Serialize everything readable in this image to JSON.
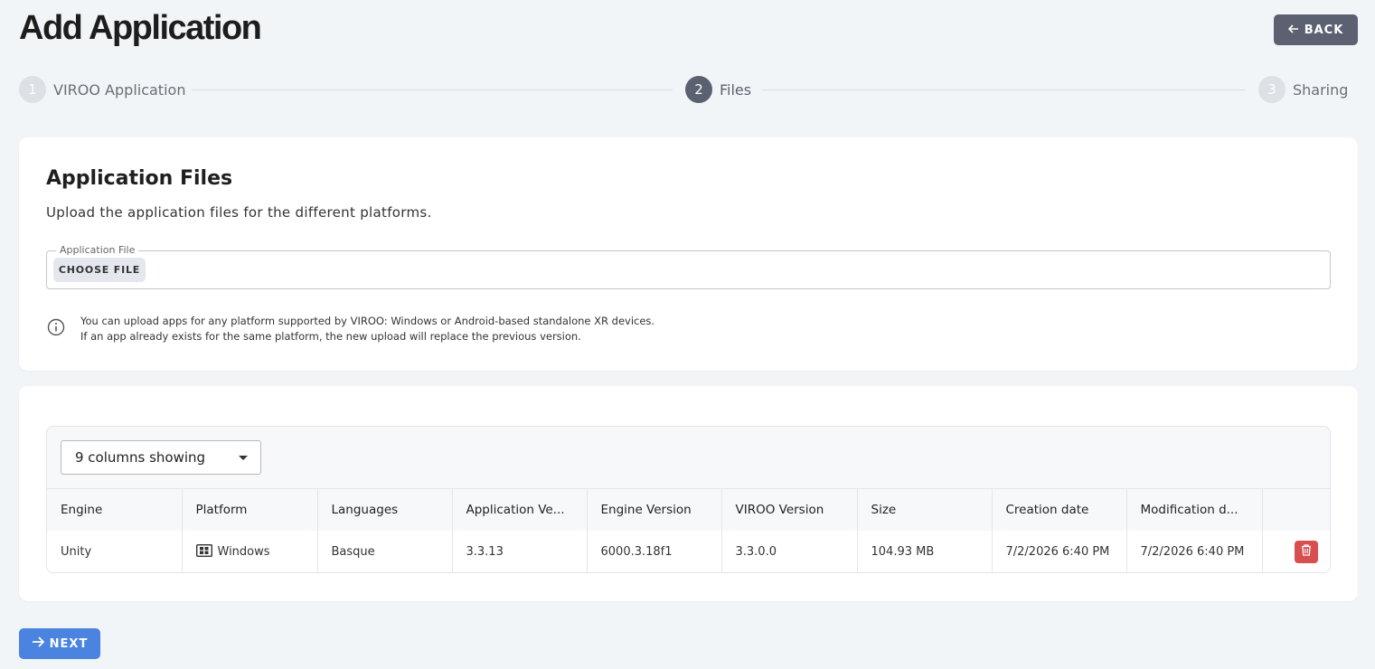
{
  "header": {
    "title": "Add Application",
    "back_label": "BACK"
  },
  "stepper": {
    "steps": [
      {
        "number": "1",
        "label": "VIROO Application",
        "active": false
      },
      {
        "number": "2",
        "label": "Files",
        "active": true
      },
      {
        "number": "3",
        "label": "Sharing",
        "active": false
      }
    ]
  },
  "upload": {
    "title": "Application Files",
    "subtitle": "Upload the application files for the different platforms.",
    "field_label": "Application File",
    "choose_label": "CHOOSE FILE",
    "info_line1": "You can upload apps for any platform supported by VIROO: Windows or Android-based standalone XR devices.",
    "info_line2": "If an app already exists for the same platform, the new upload will replace the previous version."
  },
  "table": {
    "columns_selector": "9 columns showing",
    "headers": [
      "Engine",
      "Platform",
      "Languages",
      "Application Ve...",
      "Engine Version",
      "VIROO Version",
      "Size",
      "Creation date",
      "Modification d..."
    ],
    "rows": [
      [
        "Unity",
        "Windows",
        "Basque",
        "3.3.13",
        "6000.3.18f1",
        "3.3.0.0",
        "104.93 MB",
        "7/2/2026 6:40 PM",
        "7/2/2026 6:40 PM"
      ]
    ]
  },
  "footer": {
    "next_label": "NEXT"
  },
  "colors": {
    "primary_dark": "#5b6170",
    "accent_blue": "#4a84e0",
    "danger": "#d94f4f",
    "background": "#f2f5f8"
  }
}
